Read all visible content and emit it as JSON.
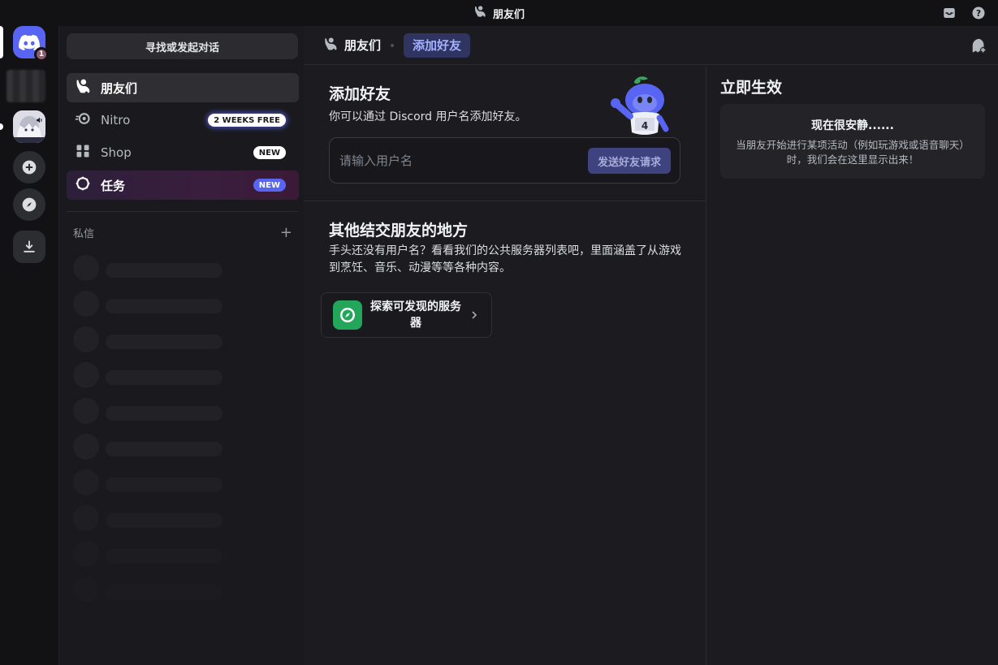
{
  "titlebar": {
    "title": "朋友们",
    "inbox_icon": "inbox-icon",
    "help_icon": "help-icon"
  },
  "rail": {
    "home_badge": "1",
    "servers": [
      "discord-home",
      "blurred-server",
      "avatar-server",
      "add-server",
      "explore-servers",
      "download-apps"
    ]
  },
  "sidebar": {
    "search_label": "寻找或发起对话",
    "items": [
      {
        "label": "朋友们",
        "icon": "friends-icon"
      },
      {
        "label": "Nitro",
        "icon": "nitro-icon",
        "tag": "2 WEEKS FREE"
      },
      {
        "label": "Shop",
        "icon": "shop-icon",
        "tag": "NEW"
      },
      {
        "label": "任务",
        "icon": "quests-icon",
        "tag": "NEW"
      }
    ],
    "dm_header": "私信",
    "dm_add": "+"
  },
  "topbar": {
    "friends_label": "朋友们",
    "add_friend_label": "添加好友"
  },
  "add_friend": {
    "title": "添加好友",
    "subtitle": "你可以通过 Discord 用户名添加好友。",
    "input_placeholder": "请输入用户名",
    "send_label": "发送好友请求"
  },
  "other_places": {
    "title": "其他结交朋友的地方",
    "description": "手头还没有用户名？看看我们的公共服务器列表吧，里面涵盖了从游戏到烹饪、音乐、动漫等等各种内容。",
    "explore_label": "探索可发现的服务器"
  },
  "active_now": {
    "title": "立即生效",
    "empty_title": "现在很安静......",
    "empty_desc": "当朋友开始进行某项活动（例如玩游戏或语音聊天）时，我们会在这里显示出来！"
  },
  "colors": {
    "accent": "#5865f2",
    "bg": "#1c1c20",
    "rail": "#121214",
    "green": "#23a55a"
  }
}
